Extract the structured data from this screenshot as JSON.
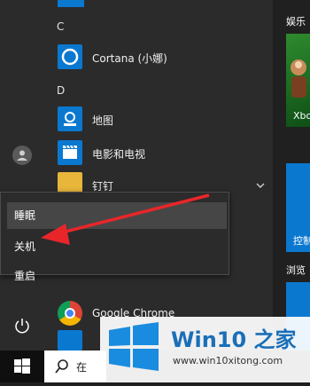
{
  "start_menu": {
    "sections": [
      {
        "letter": "C",
        "apps": [
          {
            "label": "Cortana (小娜)",
            "icon": "cortana-icon"
          }
        ]
      },
      {
        "letter": "D",
        "apps": [
          {
            "label": "地图",
            "icon": "maps-icon"
          },
          {
            "label": "电影和电视",
            "icon": "movies-tv-icon"
          },
          {
            "label": "钉钉",
            "icon": "folder-icon"
          }
        ]
      }
    ],
    "partial_app": {
      "label": "Google Chrome",
      "icon": "chrome-icon"
    }
  },
  "tiles": {
    "group1_header": "娱乐",
    "xbox_label": "Xbo",
    "control_label": "控制",
    "group2_header": "浏览"
  },
  "power_menu": {
    "items": [
      "睡眠",
      "关机",
      "重启"
    ]
  },
  "taskbar": {
    "search_text": "在"
  },
  "watermark": {
    "title": "Win10 之家",
    "url": "www.win10xitong.com"
  },
  "colors": {
    "accent": "#0b78d0",
    "annotation_arrow": "#e8262a"
  }
}
